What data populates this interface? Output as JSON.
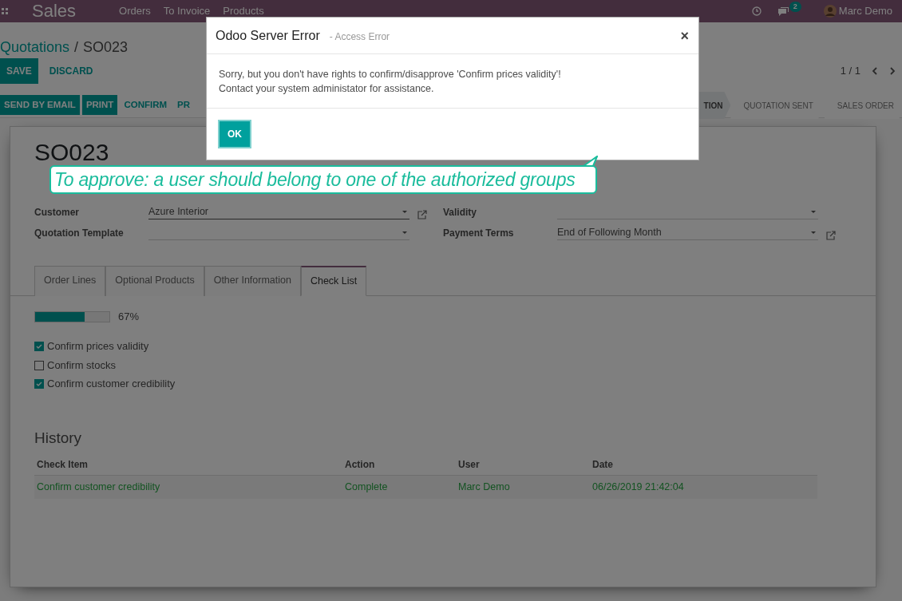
{
  "navbar": {
    "app": "Sales",
    "menu": [
      "Orders",
      "To Invoice",
      "Products"
    ],
    "messages_count": "2",
    "user": "Marc Demo"
  },
  "breadcrumb": {
    "parent": "Quotations",
    "separator": "/",
    "current": "SO023"
  },
  "edit_buttons": [
    {
      "label": "SAVE",
      "kind": "primary"
    },
    {
      "label": "DISCARD",
      "kind": "link"
    }
  ],
  "pager": "1 / 1",
  "action_buttons": [
    {
      "label": "SEND BY EMAIL",
      "kind": "primary"
    },
    {
      "label": "PRINT",
      "kind": "primary"
    },
    {
      "label": "CONFIRM",
      "kind": "link"
    },
    {
      "label": "PR",
      "kind": "link"
    }
  ],
  "statusbar": [
    {
      "label": "TION",
      "selected": true
    },
    {
      "label": "QUOTATION SENT",
      "selected": false
    },
    {
      "label": "SALES ORDER",
      "selected": false
    }
  ],
  "record_name": "SO023",
  "fields_left": [
    {
      "label": "Customer",
      "value": "Azure Interior",
      "external_link": true,
      "focused": true
    },
    {
      "label": "Quotation Template",
      "external_link": false,
      "focused": false
    }
  ],
  "fields_right": [
    {
      "label": "Validity",
      "external_link": false,
      "focused": false
    },
    {
      "label": "Payment Terms",
      "value": "End of Following Month",
      "external_link": true,
      "focused": false
    }
  ],
  "tabs": [
    {
      "label": "Order Lines",
      "selected": false
    },
    {
      "label": "Optional Products",
      "selected": false
    },
    {
      "label": "Other Information",
      "selected": false
    },
    {
      "label": "Check List",
      "selected": true
    }
  ],
  "checklist": {
    "level": 0.67,
    "reading": "67%",
    "items": [
      {
        "label": "Confirm prices validity",
        "checked": true
      },
      {
        "label": "Confirm stocks",
        "checked": false
      },
      {
        "label": "Confirm customer credibility",
        "checked": true
      }
    ]
  },
  "history": {
    "title": "History",
    "columns": [
      "Check Item",
      "Action",
      "User",
      "Date"
    ],
    "rows": [
      [
        "Confirm customer credibility",
        "Complete",
        "Marc Demo",
        "06/26/2019 21:42:04"
      ]
    ]
  },
  "dialog": {
    "title": "Odoo Server Error",
    "subtitle": "- Access Error",
    "close": "×",
    "message_lines": [
      "Sorry, but you don't have rights to confirm/disapprove 'Confirm prices validity'!",
      "Contact your system administator for assistance."
    ],
    "button": "OK"
  },
  "callout": "To approve: a user should belong to one of the authorized groups"
}
